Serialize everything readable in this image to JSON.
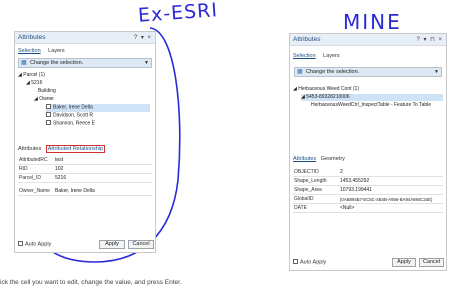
{
  "annotations": {
    "left_label": "Ex-ESRI",
    "right_label": "MINE"
  },
  "left_panel": {
    "title": "Attributes",
    "title_controls": "? ▾ ×",
    "tabs": [
      "Selection",
      "Layers"
    ],
    "dropdown_label": "Change the selection.",
    "tree": [
      "Parcel (1)",
      "5216",
      "Building",
      "Owner",
      "Baker, Irene Della",
      "Davidson, Scott R",
      "Shannon, Reece E"
    ],
    "bottom_tabs": [
      "Attributes",
      "Attributed Relationship"
    ],
    "fields": [
      {
        "k": "AttributedRC",
        "v": "test"
      },
      {
        "k": "RID",
        "v": "102"
      },
      {
        "k": "Parcel_ID",
        "v": "5216"
      },
      {
        "k": "Owner_Name",
        "v": "Baker, Irene Della"
      }
    ],
    "auto_apply": "Auto Apply",
    "apply": "Apply",
    "cancel": "Cancel"
  },
  "right_panel": {
    "title": "Attributes",
    "title_controls": "? ▾ ⊓ ×",
    "tabs": [
      "Selection",
      "Layers"
    ],
    "dropdown_label": "Change the selection.",
    "tree": [
      "Herbaceous Weed Cont (1)",
      "5453-89328210006",
      "HerbaceousWeedCtrl_InspectTable - Feature To Table"
    ],
    "bottom_tabs": [
      "Attributes",
      "Geometry"
    ],
    "fields": [
      {
        "k": "OBJECTID",
        "v": "2"
      },
      {
        "k": "Shape_Length",
        "v": "1453.455292"
      },
      {
        "k": "Shape_Area",
        "v": "10793.199441"
      },
      {
        "k": "GlobalID",
        "v": "{0AB894B7-EC5C-4B4B-A956-BA94A894C34E}"
      },
      {
        "k": "DATE",
        "v": "<Null>"
      }
    ],
    "auto_apply": "Auto Apply",
    "apply": "Apply",
    "cancel": "Cancel"
  },
  "caption": "ick the cell you want to edit, change the value, and press Enter."
}
